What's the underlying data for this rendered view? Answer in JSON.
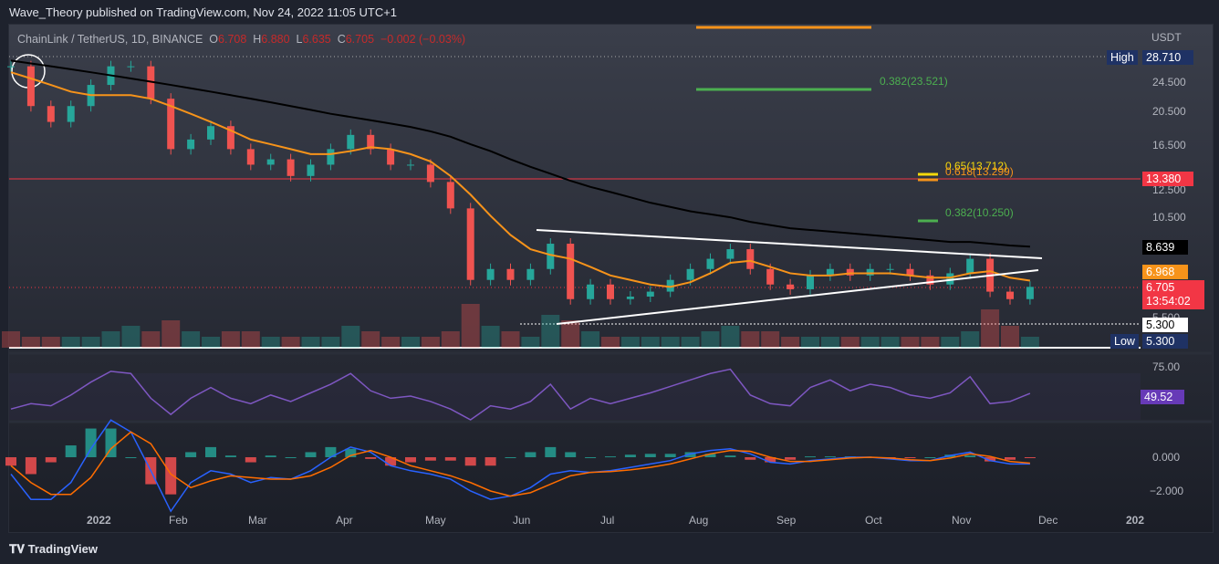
{
  "header": {
    "published": "Wave_Theory published on TradingView.com, Nov 24, 2022 11:05 UTC+1"
  },
  "legend": {
    "symbol": "ChainLink / TetherUS, 1D, BINANCE",
    "o_label": "O",
    "o": "6.708",
    "h_label": "H",
    "h": "6.880",
    "l_label": "L",
    "l": "6.635",
    "c_label": "C",
    "c": "6.705",
    "change": "−0.002 (−0.03%)"
  },
  "price_axis": {
    "currency": "USDT",
    "ticks": [
      "24.500",
      "20.500",
      "16.500",
      "12.500",
      "10.500",
      "5.500"
    ],
    "high_label": "High",
    "high_value": "28.710",
    "low_label": "Low",
    "low_value": "5.300",
    "tag_level": "13.380",
    "tag_ma200": "8.639",
    "tag_ma50": "6.968",
    "tag_last": "6.705",
    "tag_countdown": "13:54:02",
    "tag_support": "5.300"
  },
  "fib_labels": {
    "f382_top": "0.382(23.521)",
    "f65": "0.65(13.712)",
    "f618": "0.618(13.299)",
    "f382": "0.382(10.250)"
  },
  "rsi_axis": {
    "tick": "75.00",
    "value": "49.52"
  },
  "macd_axis": {
    "ticks": [
      "0.000",
      "−2.000"
    ]
  },
  "time_axis": [
    "2022",
    "Feb",
    "Mar",
    "Apr",
    "May",
    "Jun",
    "Jul",
    "Aug",
    "Sep",
    "Oct",
    "Nov",
    "Dec",
    "202"
  ],
  "footer": {
    "brand": "TradingView"
  },
  "colors": {
    "up": "#26a69a",
    "down": "#ef5350",
    "ma50": "#f7931a",
    "ma200": "#000000",
    "rsi": "#7e57c2",
    "macd": "#2962ff",
    "signal": "#ff6d00"
  },
  "chart_data": {
    "type": "line",
    "title": "ChainLink / TetherUS, 1D, BINANCE",
    "x_start": "2021-12-01",
    "x_step": "1 week",
    "ylabel": "USDT",
    "ylim": [
      5.3,
      28.71
    ],
    "yscale": "log",
    "series": [
      {
        "name": "LINKUSDT close",
        "values": [
          27,
          21,
          19,
          21,
          24,
          27,
          27,
          22,
          16,
          17,
          18.5,
          16,
          14.5,
          15,
          13.5,
          14.5,
          16,
          17.5,
          16,
          14.5,
          14.5,
          13,
          11,
          7,
          7.5,
          7,
          7.5,
          8.8,
          6.2,
          6.8,
          6.2,
          6.3,
          6.5,
          7,
          7.5,
          8,
          8.5,
          7.5,
          6.8,
          6.6,
          7.2,
          7.5,
          7.2,
          7.5,
          7.5,
          7.2,
          6.8,
          7.3,
          8,
          6.5,
          6.2,
          6.7
        ]
      },
      {
        "name": "MA 50",
        "values": [
          26,
          25,
          24,
          23,
          22.5,
          22.5,
          22.5,
          22,
          21,
          20,
          19,
          18,
          17,
          16.5,
          16,
          15.5,
          15.5,
          15.8,
          16.2,
          16,
          15.5,
          14.8,
          13.5,
          12,
          10.5,
          9.3,
          8.5,
          8.2,
          8,
          7.6,
          7.2,
          7,
          6.8,
          6.7,
          6.9,
          7.3,
          7.8,
          7.9,
          7.6,
          7.3,
          7.2,
          7.2,
          7.3,
          7.3,
          7.3,
          7.2,
          7.1,
          7.1,
          7.3,
          7.4,
          7.1,
          6.97
        ]
      },
      {
        "name": "MA 200",
        "values": [
          28,
          27.5,
          27,
          26.5,
          26,
          25.5,
          25,
          24.5,
          24,
          23.5,
          23,
          22.5,
          22,
          21.5,
          21,
          20.5,
          20,
          19.6,
          19.2,
          18.8,
          18.4,
          17.9,
          17.3,
          16.5,
          15.8,
          15,
          14.3,
          13.7,
          13.1,
          12.6,
          12.2,
          11.8,
          11.4,
          11.1,
          10.8,
          10.6,
          10.4,
          10.1,
          9.9,
          9.7,
          9.6,
          9.5,
          9.4,
          9.3,
          9.2,
          9.1,
          9,
          8.9,
          8.9,
          8.8,
          8.7,
          8.64
        ]
      },
      {
        "name": "Volume (relative)",
        "values": [
          3,
          2,
          2,
          2,
          2,
          3,
          4,
          3,
          5,
          3,
          2,
          3,
          3,
          2,
          2,
          2,
          2,
          4,
          3,
          2,
          2,
          2,
          3,
          8,
          4,
          3,
          2,
          6,
          5,
          3,
          2,
          2,
          2,
          2,
          2,
          3,
          4,
          3,
          3,
          2,
          2,
          2,
          2,
          2,
          2,
          2,
          2,
          2,
          3,
          7,
          4,
          2
        ]
      },
      {
        "name": "RSI",
        "values": [
          35,
          40,
          38,
          48,
          60,
          70,
          68,
          45,
          30,
          45,
          55,
          45,
          40,
          48,
          42,
          50,
          58,
          68,
          52,
          45,
          47,
          42,
          35,
          25,
          38,
          35,
          42,
          58,
          35,
          45,
          40,
          45,
          50,
          56,
          62,
          68,
          72,
          48,
          40,
          38,
          55,
          62,
          52,
          58,
          55,
          48,
          45,
          50,
          65,
          40,
          42,
          49.52
        ]
      },
      {
        "name": "MACD",
        "values": [
          -1,
          -2.5,
          -2.5,
          -1.5,
          0.5,
          2.2,
          1.5,
          -0.8,
          -3.2,
          -1.5,
          -0.8,
          -1,
          -1.5,
          -1.2,
          -1.3,
          -0.8,
          0,
          0.6,
          0.3,
          -0.5,
          -0.8,
          -1,
          -1.3,
          -2,
          -2.5,
          -2.3,
          -1.8,
          -1,
          -0.8,
          -0.9,
          -0.8,
          -0.6,
          -0.4,
          -0.2,
          0.2,
          0.4,
          0.5,
          0.2,
          -0.3,
          -0.4,
          -0.2,
          -0.1,
          0,
          0,
          -0.1,
          -0.2,
          -0.2,
          0.1,
          0.3,
          -0.2,
          -0.4,
          -0.4
        ]
      },
      {
        "name": "Signal",
        "values": [
          -0.5,
          -1.5,
          -2.2,
          -2.2,
          -1.2,
          0.5,
          1.5,
          0.8,
          -1,
          -1.8,
          -1.4,
          -1.1,
          -1.2,
          -1.3,
          -1.3,
          -1.1,
          -0.6,
          0.1,
          0.4,
          0,
          -0.5,
          -0.8,
          -1.1,
          -1.5,
          -2,
          -2.3,
          -2.1,
          -1.6,
          -1.1,
          -0.9,
          -0.85,
          -0.75,
          -0.6,
          -0.4,
          -0.1,
          0.2,
          0.4,
          0.35,
          0,
          -0.25,
          -0.25,
          -0.15,
          -0.05,
          0,
          -0.05,
          -0.15,
          -0.2,
          -0.05,
          0.2,
          0.05,
          -0.25,
          -0.35
        ]
      }
    ]
  }
}
